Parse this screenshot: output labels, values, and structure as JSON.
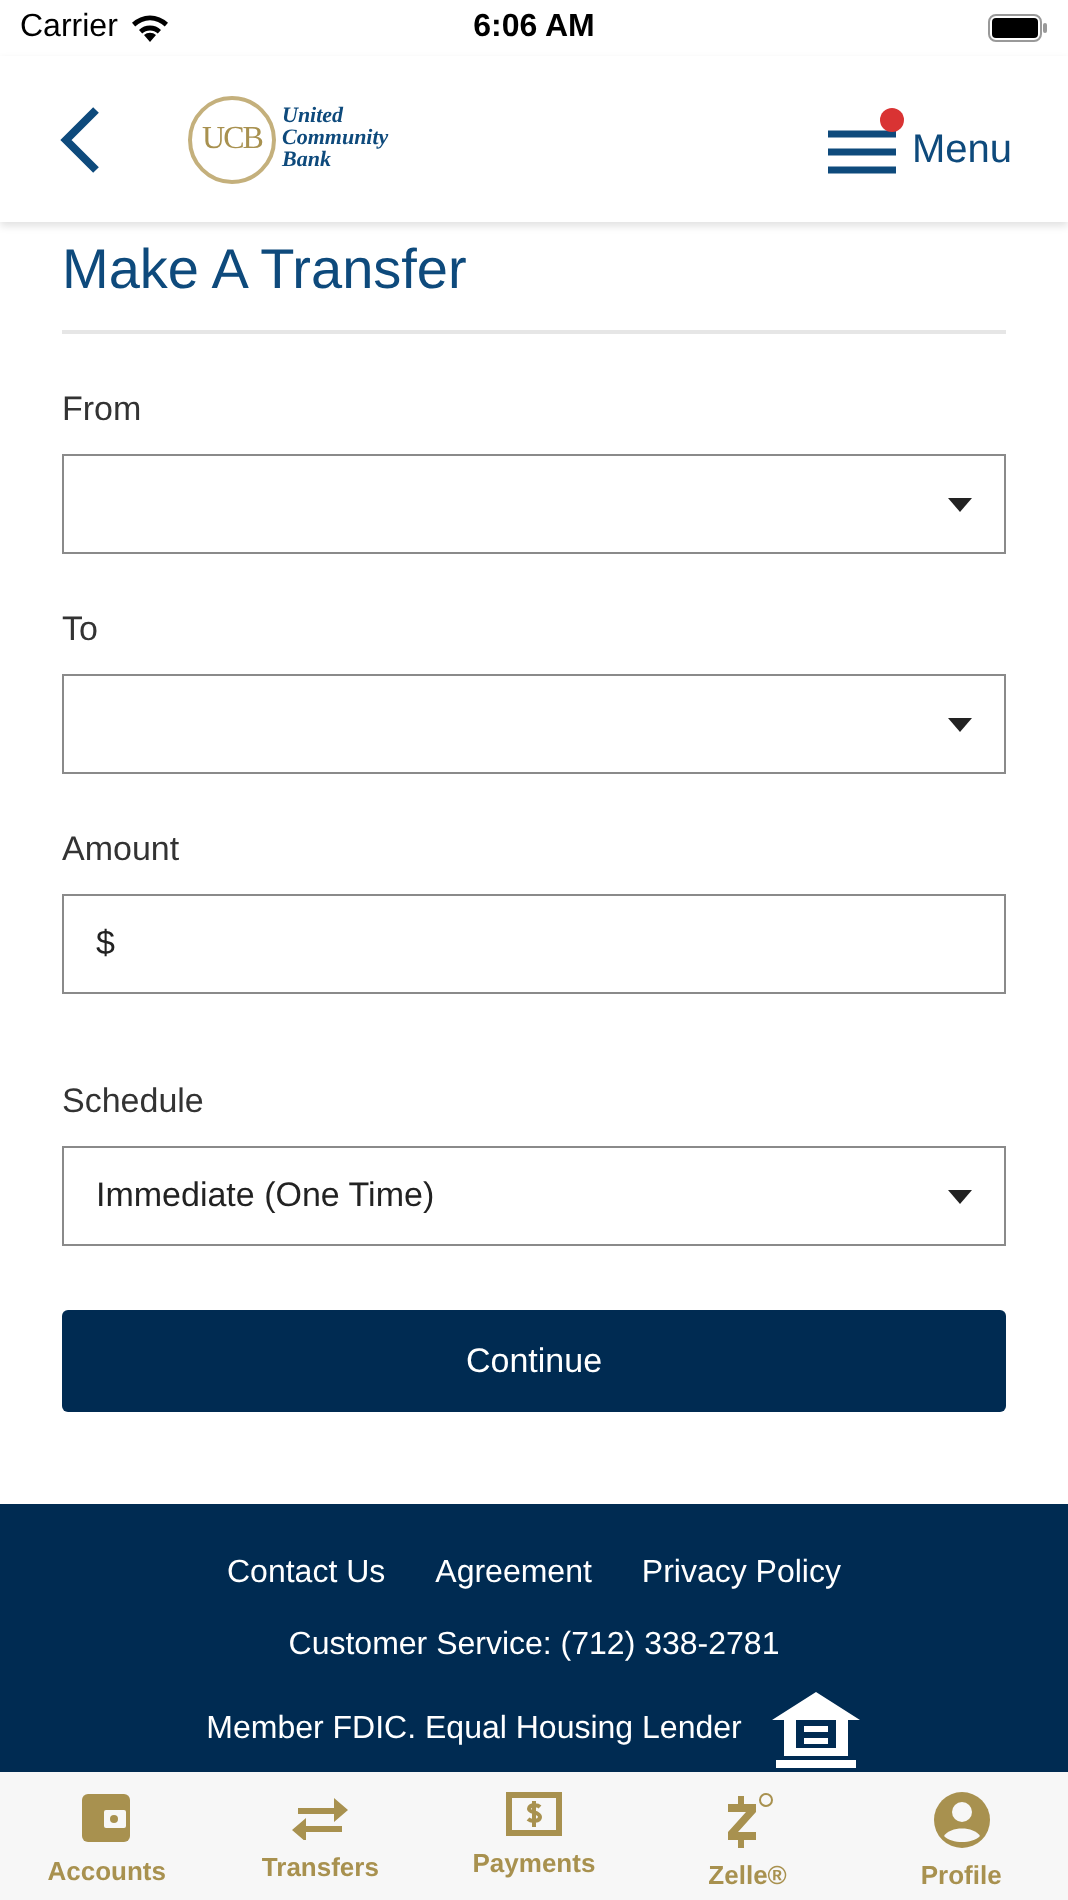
{
  "status_bar": {
    "carrier": "Carrier",
    "time": "6:06 AM"
  },
  "header": {
    "logo_initials": "UCB",
    "logo_name": [
      "United",
      "Community",
      "Bank"
    ],
    "menu_label": "Menu",
    "menu_badge": true
  },
  "title": "Make A Transfer",
  "fields": [
    {
      "kind": "select",
      "label": "From"
    },
    {
      "kind": "select",
      "label": "To"
    },
    {
      "kind": "input",
      "label": "Amount",
      "prefix": "$"
    },
    {
      "kind": "select",
      "label": "Schedule",
      "value": "Immediate (One Time)"
    }
  ],
  "continue_button": "Continue",
  "footer": {
    "links": [
      "Contact Us",
      "Agreement",
      "Privacy Policy"
    ],
    "customer_service": "Customer Service: (712) 338-2781",
    "member": "Member FDIC. Equal Housing Lender"
  },
  "tab_bar": [
    {
      "kind": "wallet",
      "label": "Accounts"
    },
    {
      "kind": "arrows",
      "label": "Transfers"
    },
    {
      "kind": "dollar",
      "label": "Payments"
    },
    {
      "kind": "zelle",
      "label": "Zelle®"
    },
    {
      "kind": "person",
      "label": "Profile"
    }
  ]
}
